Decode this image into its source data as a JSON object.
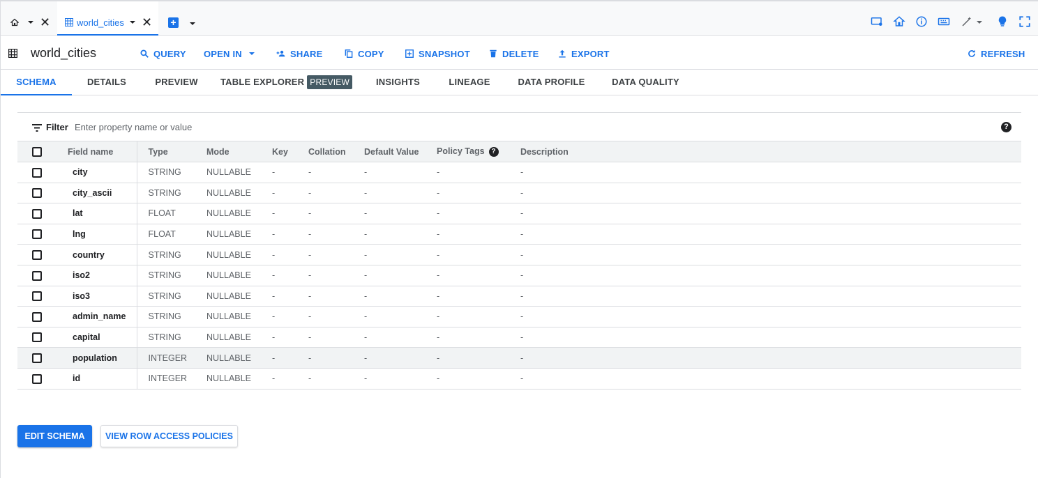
{
  "colors": {
    "accent": "#1a73e8",
    "text": "#202124",
    "muted": "#5f6368",
    "border": "#dadce0",
    "badge": "#455a64"
  },
  "tabstrip": {
    "home_icon": "home-icon",
    "active_tab": {
      "label": "world_cities",
      "icon": "table-icon"
    },
    "new_tab_icon": "add-box-icon",
    "right_icons": [
      "tv-icon",
      "home-icon",
      "info-icon",
      "keyboard-icon",
      "magic-wand-icon",
      "lightbulb-icon",
      "fullscreen-icon"
    ]
  },
  "toolbar": {
    "title": "world_cities",
    "buttons": {
      "query": "QUERY",
      "open_in": "OPEN IN",
      "share": "SHARE",
      "copy": "COPY",
      "snapshot": "SNAPSHOT",
      "delete": "DELETE",
      "export": "EXPORT",
      "refresh": "REFRESH"
    }
  },
  "subtabs": {
    "schema": "SCHEMA",
    "details": "DETAILS",
    "preview": "PREVIEW",
    "table_explorer": "TABLE EXPLORER",
    "table_explorer_badge": "PREVIEW",
    "insights": "INSIGHTS",
    "lineage": "LINEAGE",
    "data_profile": "DATA PROFILE",
    "data_quality": "DATA QUALITY"
  },
  "filter": {
    "label": "Filter",
    "placeholder": "Enter property name or value"
  },
  "table": {
    "headers": {
      "field_name": "Field name",
      "type": "Type",
      "mode": "Mode",
      "key": "Key",
      "collation": "Collation",
      "default_value": "Default Value",
      "policy_tags": "Policy Tags",
      "description": "Description"
    },
    "rows": [
      {
        "name": "city",
        "type": "STRING",
        "mode": "NULLABLE",
        "key": "-",
        "collation": "-",
        "default": "-",
        "policy": "-",
        "description": "-"
      },
      {
        "name": "city_ascii",
        "type": "STRING",
        "mode": "NULLABLE",
        "key": "-",
        "collation": "-",
        "default": "-",
        "policy": "-",
        "description": "-"
      },
      {
        "name": "lat",
        "type": "FLOAT",
        "mode": "NULLABLE",
        "key": "-",
        "collation": "-",
        "default": "-",
        "policy": "-",
        "description": "-"
      },
      {
        "name": "lng",
        "type": "FLOAT",
        "mode": "NULLABLE",
        "key": "-",
        "collation": "-",
        "default": "-",
        "policy": "-",
        "description": "-"
      },
      {
        "name": "country",
        "type": "STRING",
        "mode": "NULLABLE",
        "key": "-",
        "collation": "-",
        "default": "-",
        "policy": "-",
        "description": "-"
      },
      {
        "name": "iso2",
        "type": "STRING",
        "mode": "NULLABLE",
        "key": "-",
        "collation": "-",
        "default": "-",
        "policy": "-",
        "description": "-"
      },
      {
        "name": "iso3",
        "type": "STRING",
        "mode": "NULLABLE",
        "key": "-",
        "collation": "-",
        "default": "-",
        "policy": "-",
        "description": "-"
      },
      {
        "name": "admin_name",
        "type": "STRING",
        "mode": "NULLABLE",
        "key": "-",
        "collation": "-",
        "default": "-",
        "policy": "-",
        "description": "-"
      },
      {
        "name": "capital",
        "type": "STRING",
        "mode": "NULLABLE",
        "key": "-",
        "collation": "-",
        "default": "-",
        "policy": "-",
        "description": "-"
      },
      {
        "name": "population",
        "type": "INTEGER",
        "mode": "NULLABLE",
        "key": "-",
        "collation": "-",
        "default": "-",
        "policy": "-",
        "description": "-"
      },
      {
        "name": "id",
        "type": "INTEGER",
        "mode": "NULLABLE",
        "key": "-",
        "collation": "-",
        "default": "-",
        "policy": "-",
        "description": "-"
      }
    ]
  },
  "footer": {
    "edit_schema": "EDIT SCHEMA",
    "view_row_access_policies": "VIEW ROW ACCESS POLICIES"
  }
}
